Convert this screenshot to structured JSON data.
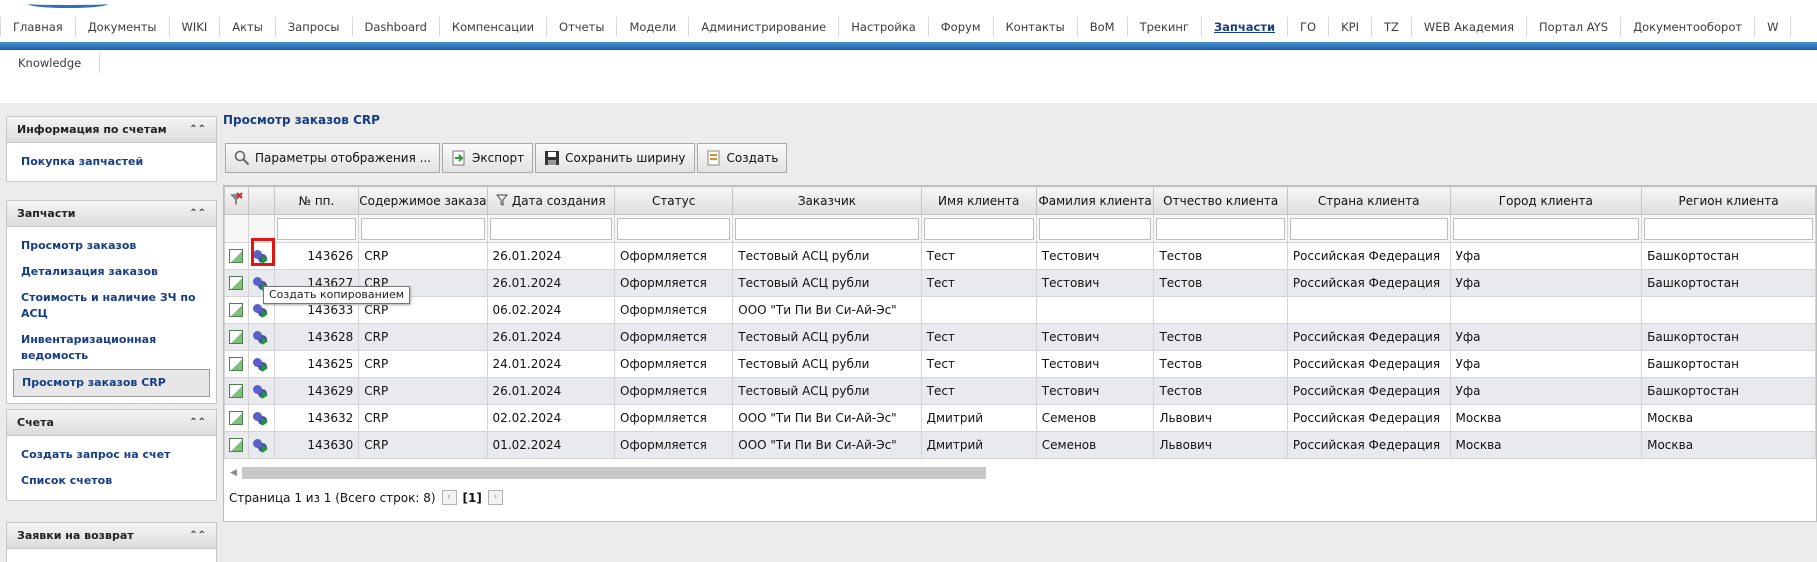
{
  "nav": {
    "items": [
      "Главная",
      "Документы",
      "WIKI",
      "Акты",
      "Запросы",
      "Dashboard",
      "Компенсации",
      "Отчеты",
      "Модели",
      "Администрирование",
      "Настройка",
      "Форум",
      "Контакты",
      "BoM",
      "Трекинг",
      "Запчасти",
      "ГО",
      "KPI",
      "TZ",
      "WEB Академия",
      "Портал AYS",
      "Документооборот",
      "W"
    ],
    "active_index": 15,
    "second_row": [
      "Knowledge"
    ]
  },
  "sidebar": [
    {
      "title": "Информация по счетам",
      "items": [
        "Покупка запчастей"
      ]
    },
    {
      "title": "Запчасти",
      "items": [
        "Просмотр заказов",
        "Детализация заказов",
        "Стоимость и наличие ЗЧ по АСЦ",
        "Инвентаризационная ведомость",
        "Просмотр заказов CRP"
      ],
      "selected": 4
    },
    {
      "title": "Счета",
      "items": [
        "Создать запрос на счет",
        "Список счетов"
      ]
    },
    {
      "title": "Заявки на возврат",
      "items": []
    }
  ],
  "page_title": "Просмотр заказов CRP",
  "toolbar": {
    "params_label": "Параметры отображения ...",
    "export_label": "Экспорт",
    "save_width_label": "Сохранить ширину",
    "create_label": "Создать"
  },
  "grid": {
    "columns": [
      "№ пп.",
      "Содержимое заказа",
      "Дата создания",
      "Статус",
      "Заказчик",
      "Имя клиента",
      "Фамилия клиента",
      "Отчество клиента",
      "Страна клиента",
      "Город клиента",
      "Регион клиента"
    ],
    "filter_icon": "filter-icon",
    "rows": [
      [
        "143626",
        "CRP",
        "26.01.2024",
        "Оформляется",
        "Тестовый АСЦ рубли",
        "Тест",
        "Тестович",
        "Тестов",
        "Российская Федерация",
        "Уфа",
        "Башкортостан"
      ],
      [
        "143627",
        "CRP",
        "26.01.2024",
        "Оформляется",
        "Тестовый АСЦ рубли",
        "Тест",
        "Тестович",
        "Тестов",
        "Российская Федерация",
        "Уфа",
        "Башкортостан"
      ],
      [
        "143633",
        "CRP",
        "06.02.2024",
        "Оформляется",
        "ООО \"Ти Пи Ви Си-Ай-Эс\"",
        "",
        "",
        "",
        "",
        "",
        ""
      ],
      [
        "143628",
        "CRP",
        "26.01.2024",
        "Оформляется",
        "Тестовый АСЦ рубли",
        "Тест",
        "Тестович",
        "Тестов",
        "Российская Федерация",
        "Уфа",
        "Башкортостан"
      ],
      [
        "143625",
        "CRP",
        "24.01.2024",
        "Оформляется",
        "Тестовый АСЦ рубли",
        "Тест",
        "Тестович",
        "Тестов",
        "Российская Федерация",
        "Уфа",
        "Башкортостан"
      ],
      [
        "143629",
        "CRP",
        "26.01.2024",
        "Оформляется",
        "Тестовый АСЦ рубли",
        "Тест",
        "Тестович",
        "Тестов",
        "Российская Федерация",
        "Уфа",
        "Башкортостан"
      ],
      [
        "143632",
        "CRP",
        "02.02.2024",
        "Оформляется",
        "ООО \"Ти Пи Ви Си-Ай-Эс\"",
        "Дмитрий",
        "Семенов",
        "Львович",
        "Российская Федерация",
        "Москва",
        "Москва"
      ],
      [
        "143630",
        "CRP",
        "01.02.2024",
        "Оформляется",
        "ООО \"Ти Пи Ви Си-Ай-Эс\"",
        "Дмитрий",
        "Семенов",
        "Львович",
        "Российская Федерация",
        "Москва",
        "Москва"
      ]
    ]
  },
  "tooltip": "Создать копированием",
  "pager": {
    "summary": "Страница 1 из 1 (Всего строк: 8)",
    "prev": "‹",
    "current": "[1]",
    "next": "›"
  },
  "colors": {
    "accent": "#163e85",
    "highlight": "#e01414"
  }
}
